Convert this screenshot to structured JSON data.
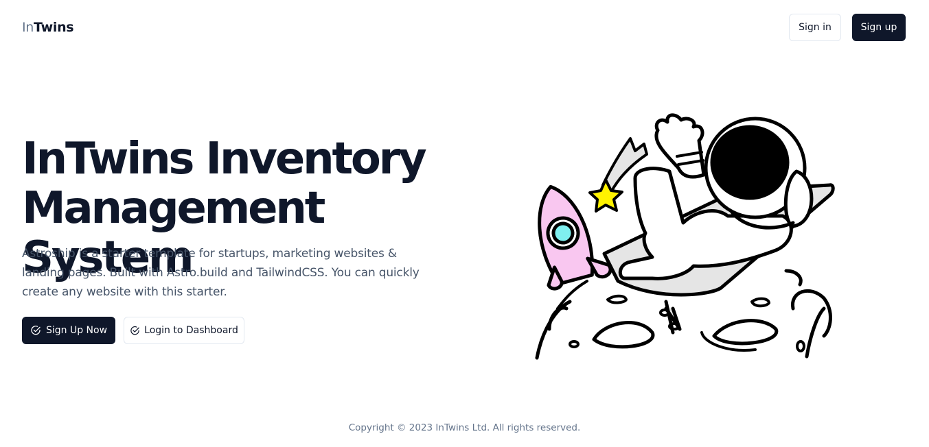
{
  "brand": {
    "prefix": "In",
    "name": "Twins"
  },
  "nav": {
    "signin_label": "Sign in",
    "signup_label": "Sign up"
  },
  "hero": {
    "title_line1": "InTwins Inventory",
    "title_line2": "Management System",
    "description": "Astroship is a starter template for startups, marketing websites & landing pages. Built with Astro.build and TailwindCSS. You can quickly create any website with this starter.",
    "primary_cta": {
      "label": "Sign Up Now",
      "icon": "check-circle-icon"
    },
    "secondary_cta": {
      "label": "Login to Dashboard",
      "icon": "check-circle-icon"
    }
  },
  "illustration": {
    "subject": "astronaut-relaxing-on-moon-with-rocket-and-star"
  },
  "footer": {
    "copyright": "Copyright © 2023 InTwins Ltd. All rights reserved."
  },
  "colors": {
    "primary": "#0f172a",
    "muted": "#64748b",
    "border": "#e2e8f0",
    "rocket": "#f9c7f0",
    "star": "#fff200",
    "window": "#7ff0f0"
  }
}
